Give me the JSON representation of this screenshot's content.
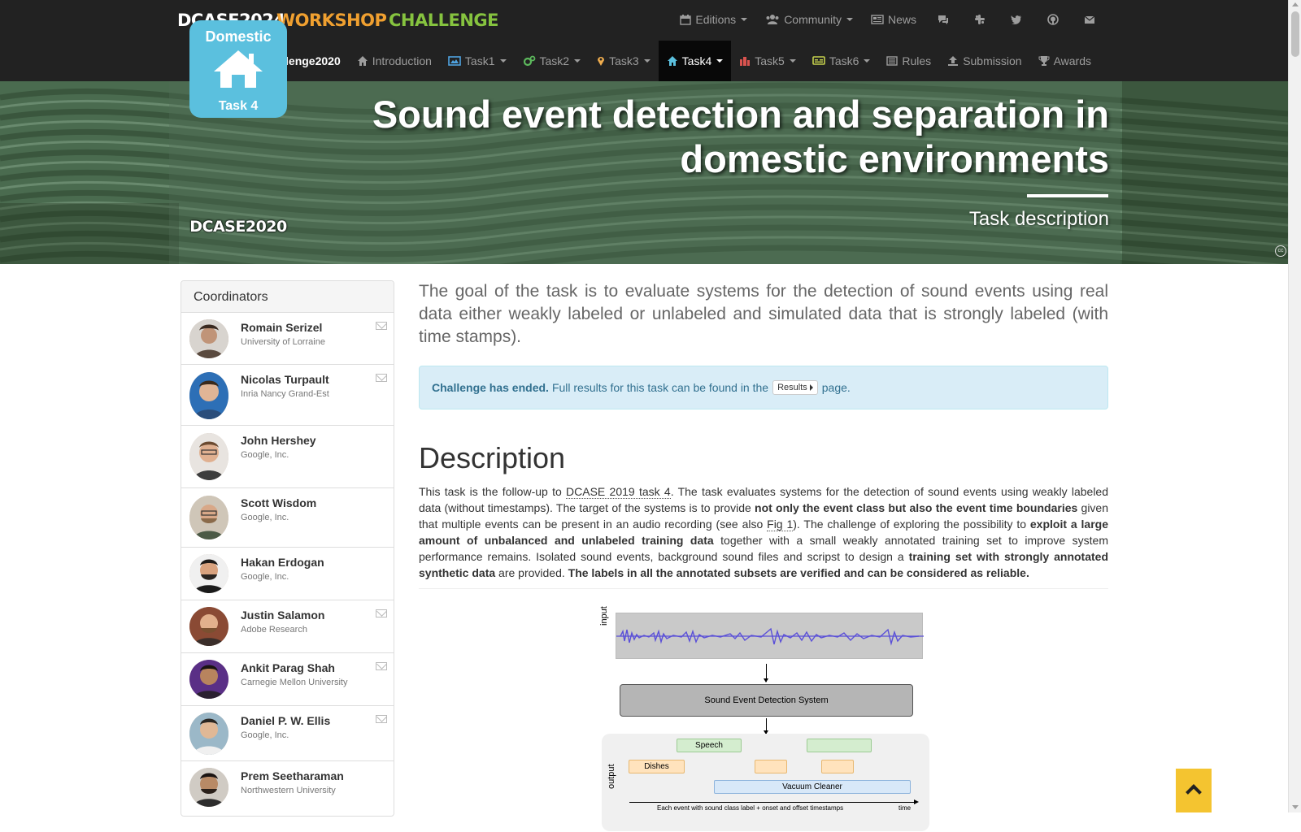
{
  "brand": {
    "dcase": "DCASE2024",
    "workshop": "WORKSHOP",
    "challenge": "CHALLENGE"
  },
  "top_nav": {
    "editions": "Editions",
    "community": "Community",
    "news": "News",
    "icons": [
      "comments-icon",
      "slack-icon",
      "twitter-icon",
      "github-icon",
      "envelope-icon"
    ]
  },
  "sub_nav": {
    "brand": "Challenge2020",
    "items": [
      {
        "label": "Introduction",
        "icon": "home-icon",
        "dropdown": false
      },
      {
        "label": "Task1",
        "icon": "image-icon",
        "dropdown": true
      },
      {
        "label": "Task2",
        "icon": "cogs-icon",
        "dropdown": true
      },
      {
        "label": "Task3",
        "icon": "map-marker-icon",
        "dropdown": true
      },
      {
        "label": "Task4",
        "icon": "home-icon",
        "dropdown": true,
        "active": true
      },
      {
        "label": "Task5",
        "icon": "city-icon",
        "dropdown": true
      },
      {
        "label": "Task6",
        "icon": "caption-icon",
        "dropdown": true
      },
      {
        "label": "Rules",
        "icon": "list-icon",
        "dropdown": false
      },
      {
        "label": "Submission",
        "icon": "upload-icon",
        "dropdown": false
      },
      {
        "label": "Awards",
        "icon": "trophy-icon",
        "dropdown": false
      }
    ]
  },
  "hero": {
    "badge_top": "Domestic",
    "badge_bottom": "Task 4",
    "edition_logo": "DCASE2020",
    "title": "Sound event detection and separation in domestic environments",
    "subtitle": "Task description"
  },
  "sidebar": {
    "title": "Coordinators",
    "coordinators": [
      {
        "name": "Romain Serizel",
        "affiliation": "University of Lorraine",
        "email": true
      },
      {
        "name": "Nicolas Turpault",
        "affiliation": "Inria Nancy Grand-Est",
        "email": true
      },
      {
        "name": "John Hershey",
        "affiliation": "Google, Inc.",
        "email": false
      },
      {
        "name": "Scott Wisdom",
        "affiliation": "Google, Inc.",
        "email": false
      },
      {
        "name": "Hakan Erdogan",
        "affiliation": "Google, Inc.",
        "email": false
      },
      {
        "name": "Justin Salamon",
        "affiliation": "Adobe Research",
        "email": true
      },
      {
        "name": "Ankit Parag Shah",
        "affiliation": "Carnegie Mellon University",
        "email": true
      },
      {
        "name": "Daniel P. W. Ellis",
        "affiliation": "Google, Inc.",
        "email": true
      },
      {
        "name": "Prem Seetharaman",
        "affiliation": "Northwestern University",
        "email": false
      }
    ]
  },
  "main": {
    "lead": "The goal of the task is to evaluate systems for the detection of sound events using real data either weakly labeled or unlabeled and simulated data that is strongly labeled (with time stamps).",
    "alert_bold": "Challenge has ended.",
    "alert_text": "Full results for this task can be found in the",
    "alert_button": "Results",
    "alert_after": "page.",
    "description_heading": "Description",
    "desc": {
      "p1": "This task is the follow-up to ",
      "link1": "DCASE 2019 task 4",
      "p2": ". The task evaluates systems for the detection of sound events using weakly labeled data (without timestamps). The target of the systems is to provide ",
      "b1": "not only the event class but also the event time boundaries",
      "p3": " given that multiple events can be present in an audio recording (see also ",
      "link2": "Fig 1",
      "p4": "). The challenge of exploring the possibility to ",
      "b2": "exploit a large amount of unbalanced and unlabeled training data",
      "p5": " together with a small weakly annotated training set to improve system performance remains. Isolated sound events, background sound files and scripst to design a ",
      "b3": "training set with strongly annotated synthetic data",
      "p6": " are provided. ",
      "b4": "The labels in all the annotated subsets are verified and can be considered as reliable."
    }
  },
  "figure": {
    "input_label": "input",
    "system_label": "Sound Event Detection System",
    "output_label": "output",
    "speech": "Speech",
    "dishes": "Dishes",
    "vacuum": "Vacuum Cleaner",
    "caption": "Each event with sound class label + onset and offset timestamps",
    "time": "time"
  },
  "colors": {
    "navbar": "#222222",
    "workshop": "#f0a030",
    "challenge": "#86c33f",
    "badge": "#5bc0de",
    "alert_bg": "#d9edf7",
    "back_to_top": "#f4c430"
  }
}
